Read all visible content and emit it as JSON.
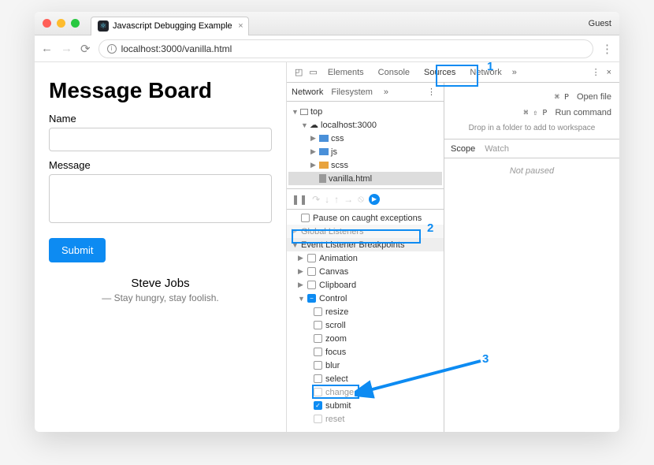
{
  "browser": {
    "tab_title": "Javascript Debugging Example",
    "guest_label": "Guest",
    "url_host": "localhost",
    "url_port": ":3000/vanilla.html"
  },
  "page": {
    "title": "Message Board",
    "name_label": "Name",
    "message_label": "Message",
    "submit_label": "Submit",
    "quote_author": "Steve Jobs",
    "quote_text": "— Stay hungry, stay foolish."
  },
  "devtools": {
    "tabs": {
      "elements": "Elements",
      "console": "Console",
      "sources": "Sources",
      "network": "Network"
    },
    "subtabs": {
      "network": "Network",
      "filesystem": "Filesystem"
    },
    "tree": {
      "top": "top",
      "host": "localhost:3000",
      "css": "css",
      "js": "js",
      "scss": "scss",
      "file": "vanilla.html"
    },
    "commands": {
      "open_key": "⌘ P",
      "open_label": "Open file",
      "run_key": "⌘ ⇧ P",
      "run_label": "Run command",
      "drop_hint": "Drop in a folder to add to workspace"
    },
    "scope": {
      "scope_tab": "Scope",
      "watch_tab": "Watch",
      "not_paused": "Not paused"
    },
    "breakpoints": {
      "pause_caught": "Pause on caught exceptions",
      "global_listeners": "Global Listeners",
      "event_listener": "Event Listener Breakpoints",
      "animation": "Animation",
      "canvas": "Canvas",
      "clipboard": "Clipboard",
      "control": "Control",
      "resize": "resize",
      "scroll": "scroll",
      "zoom": "zoom",
      "focus": "focus",
      "blur": "blur",
      "select": "select",
      "change": "change",
      "submit": "submit",
      "reset": "reset"
    }
  },
  "callouts": {
    "one": "1",
    "two": "2",
    "three": "3"
  }
}
